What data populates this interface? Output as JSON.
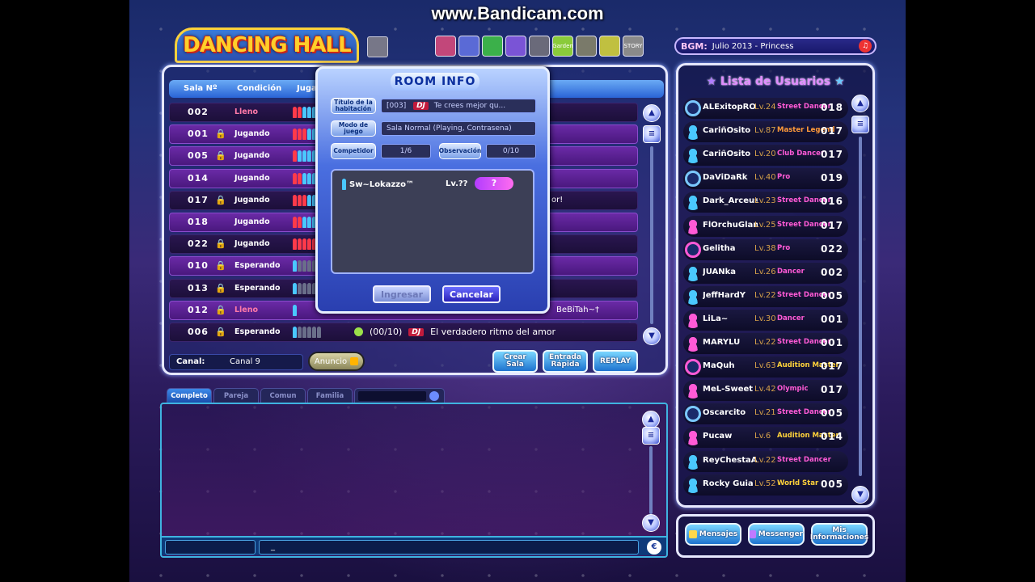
{
  "watermark": "www.Bandicam.com",
  "logo": "DANCING HALL",
  "top_icons": [
    {
      "name": "icon-1",
      "color": "#c2477a",
      "text": ""
    },
    {
      "name": "icon-2",
      "color": "#5a6ad6",
      "text": ""
    },
    {
      "name": "icon-3",
      "color": "#3bb04a",
      "text": ""
    },
    {
      "name": "icon-4",
      "color": "#7a54d6",
      "text": ""
    },
    {
      "name": "icon-5",
      "color": "#6a6a7a",
      "text": ""
    },
    {
      "name": "icon-garden",
      "color": "#8acb3a",
      "text": "Garden"
    },
    {
      "name": "icon-7",
      "color": "#7a7a6a",
      "text": ""
    },
    {
      "name": "icon-8",
      "color": "#c0c040",
      "text": ""
    },
    {
      "name": "icon-story",
      "color": "#8a8a8a",
      "text": "STORY"
    }
  ],
  "bgm": {
    "label": "BGM:",
    "value": "Julio 2013 - Princess"
  },
  "room_list": {
    "headers": {
      "sala": "Sala Nº",
      "condicion": "Condición",
      "jugadores": "Jugado"
    },
    "rows": [
      {
        "num": "002",
        "lock": "",
        "cond": "Lleno",
        "cond_color": "#ff7aa8",
        "players": [
          "r",
          "r",
          "b",
          "b",
          "b",
          "b"
        ],
        "tail": "",
        "dark": true
      },
      {
        "num": "001",
        "lock": "🔒",
        "cond": "Jugando",
        "cond_color": "#ffffff",
        "players": [
          "r",
          "r",
          "r",
          "b",
          "b",
          "b"
        ],
        "tail": "",
        "dark": false
      },
      {
        "num": "005",
        "lock": "🔒",
        "cond": "Jugando",
        "cond_color": "#ffffff",
        "players": [
          "r",
          "b",
          "b",
          "b",
          "b",
          "b"
        ],
        "tail": "",
        "dark": false
      },
      {
        "num": "014",
        "lock": "",
        "cond": "Jugando",
        "cond_color": "#ffffff",
        "players": [
          "r",
          "r",
          "b",
          "b",
          "b"
        ],
        "tail": "",
        "dark": false
      },
      {
        "num": "017",
        "lock": "🔒",
        "cond": "Jugando",
        "cond_color": "#ffffff",
        "players": [
          "r",
          "r",
          "r",
          "b",
          "b",
          "b"
        ],
        "tail": "or!",
        "dark": true
      },
      {
        "num": "018",
        "lock": "",
        "cond": "Jugando",
        "cond_color": "#ffffff",
        "players": [
          "r",
          "r",
          "b",
          "b",
          "b",
          "b"
        ],
        "tail": "",
        "dark": false
      },
      {
        "num": "022",
        "lock": "🔒",
        "cond": "Jugando",
        "cond_color": "#ffffff",
        "players": [
          "r",
          "r",
          "r",
          "r",
          "r",
          "r"
        ],
        "tail": "",
        "dark": true
      },
      {
        "num": "010",
        "lock": "🔒",
        "cond": "Esperando",
        "cond_color": "#ffffff",
        "players": [
          "b",
          "g",
          "g",
          "g",
          "g",
          "g"
        ],
        "tail": "",
        "dark": false
      },
      {
        "num": "013",
        "lock": "🔒",
        "cond": "Esperando",
        "cond_color": "#ffffff",
        "players": [
          "b",
          "g",
          "g",
          "g",
          "g",
          "g"
        ],
        "tail": "",
        "dark": true
      },
      {
        "num": "012",
        "lock": "🔒",
        "cond": "Lleno",
        "cond_color": "#ff7aa8",
        "players": [
          "b"
        ],
        "tail": "BeBiTah~†",
        "dark": false
      },
      {
        "num": "006",
        "lock": "🔒",
        "cond": "Esperando",
        "cond_color": "#ffffff",
        "players": [
          "b",
          "g",
          "g",
          "g",
          "g",
          "g"
        ],
        "extra": {
          "count": "(00/10)",
          "dj": "DJ",
          "title": "El verdadero ritmo del amor"
        },
        "tail": "",
        "dark": true
      }
    ]
  },
  "canal": {
    "label": "Canal:",
    "value": "Canal 9"
  },
  "anuncio": "Anuncio",
  "buttons": {
    "crear": "Crear Sala",
    "entrada": "Entrada Rápida",
    "replay": "REPLAY"
  },
  "chat_tabs": [
    "Completo",
    "Pareja",
    "Comun",
    "Familia"
  ],
  "chat_input": "_",
  "room_info": {
    "title": "ROOM INFO",
    "label_title": "Título de la habitación",
    "room_num": "[003]",
    "dj": "DJ",
    "room_name": "Te crees mejor qu...",
    "label_mode": "Modo de juego",
    "mode_value": "Sala Normal  (Playing, Contrasena)",
    "label_comp": "Competidor",
    "comp_value": "1/6",
    "label_obs": "Observación",
    "obs_value": "0/10",
    "player_name": "Sw~Lokazzo™",
    "player_level": "Lv.??",
    "btn_ingresar": "Ingresar",
    "btn_cancelar": "Cancelar"
  },
  "user_list": {
    "title": "Lista de Usuarios",
    "users": [
      {
        "name": "ALExitopRO",
        "lv": "Lv.24",
        "title": "Street Dancer",
        "title_color": "#ff5ad6",
        "room": "018",
        "av": "ring",
        "gender": "b"
      },
      {
        "name": "CariñOsito",
        "lv": "Lv.87",
        "title": "Master Legend",
        "title_color": "#ff9a3a",
        "room": "017",
        "av": "plain",
        "gender": "b"
      },
      {
        "name": "CariñOsito",
        "lv": "Lv.20",
        "title": "Club Dancer",
        "title_color": "#ff5ad6",
        "room": "017",
        "av": "plain",
        "gender": "b"
      },
      {
        "name": "DaViDaRk",
        "lv": "Lv.40",
        "title": "Pro",
        "title_color": "#ff5ad6",
        "room": "019",
        "av": "ring",
        "gender": "b"
      },
      {
        "name": "Dark_Arceus",
        "lv": "Lv.23",
        "title": "Street Dancer",
        "title_color": "#ff5ad6",
        "room": "016",
        "av": "plain",
        "gender": "b"
      },
      {
        "name": "FlOrchuGlamh",
        "lv": "Lv.25",
        "title": "Street Dancer",
        "title_color": "#ff5ad6",
        "room": "017",
        "av": "plain",
        "gender": "p"
      },
      {
        "name": "Gelitha",
        "lv": "Lv.38",
        "title": "Pro",
        "title_color": "#ff5ad6",
        "room": "022",
        "av": "ring",
        "gender": "p"
      },
      {
        "name": "JUANka",
        "lv": "Lv.26",
        "title": "Dancer",
        "title_color": "#ff5ad6",
        "room": "002",
        "av": "plain",
        "gender": "b"
      },
      {
        "name": "JeffHardY",
        "lv": "Lv.22",
        "title": "Street Dancer",
        "title_color": "#ff5ad6",
        "room": "005",
        "av": "plain",
        "gender": "b"
      },
      {
        "name": "LiLa~",
        "lv": "Lv.30",
        "title": "Dancer",
        "title_color": "#ff5ad6",
        "room": "001",
        "av": "plain",
        "gender": "p"
      },
      {
        "name": "MARYLU",
        "lv": "Lv.22",
        "title": "Street Dancer",
        "title_color": "#ff5ad6",
        "room": "001",
        "av": "plain",
        "gender": "p"
      },
      {
        "name": "MaQuh",
        "lv": "Lv.63",
        "title": "Audition Master",
        "title_color": "#ffd23a",
        "room": "017",
        "av": "ring",
        "gender": "p"
      },
      {
        "name": "MeL-Sweet",
        "lv": "Lv.42",
        "title": "Olympic",
        "title_color": "#ff5ad6",
        "room": "017",
        "av": "plain",
        "gender": "p"
      },
      {
        "name": "Oscarcito",
        "lv": "Lv.21",
        "title": "Street Dancer",
        "title_color": "#ff5ad6",
        "room": "005",
        "av": "ring",
        "gender": "b"
      },
      {
        "name": "Pucaw",
        "lv": "Lv.6",
        "title": "Audition Master",
        "title_color": "#ffd23a",
        "room": "014",
        "av": "plain",
        "gender": "p"
      },
      {
        "name": "ReyChestaAL",
        "lv": "Lv.22",
        "title": "Street Dancer",
        "title_color": "#ff5ad6",
        "room": "",
        "av": "plain",
        "gender": "b"
      },
      {
        "name": "Rocky Guia",
        "lv": "Lv.52",
        "title": "World Star",
        "title_color": "#ffd23a",
        "room": "005",
        "av": "plain",
        "gender": "b"
      }
    ]
  },
  "bottom_buttons": {
    "mensajes": "Mensajes",
    "messenger": "Messenger",
    "info": "Mis Informaciones"
  }
}
